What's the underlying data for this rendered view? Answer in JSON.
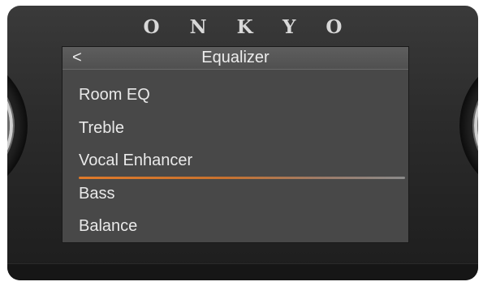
{
  "device": {
    "brand": "ONKYO"
  },
  "screen": {
    "title": "Equalizer",
    "back_symbol": "<",
    "menu_items": [
      {
        "label": "Room EQ"
      },
      {
        "label": "Treble"
      },
      {
        "label": "Vocal Enhancer",
        "selected": true
      },
      {
        "label": "Bass"
      },
      {
        "label": "Balance"
      }
    ]
  },
  "colors": {
    "accent": "#e07a2a",
    "text": "#e9e9e9",
    "screen_bg": "#484848"
  }
}
